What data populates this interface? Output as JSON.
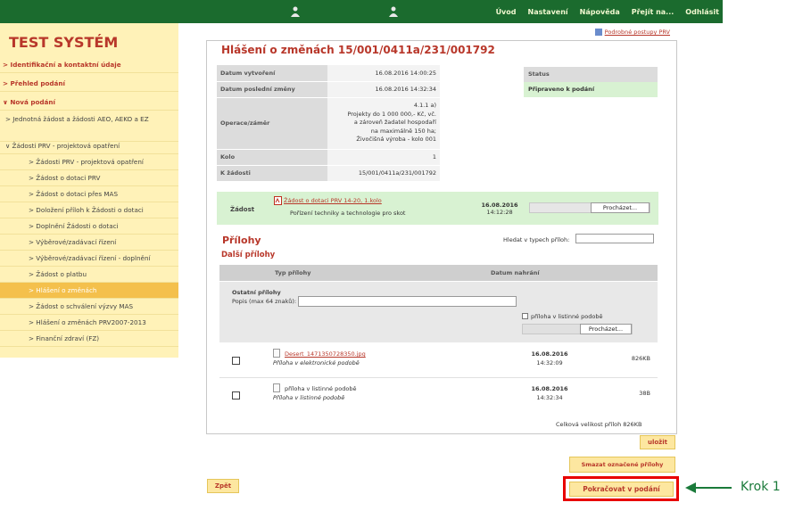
{
  "topnav": {
    "items": [
      "Úvod",
      "Nastavení",
      "Nápověda",
      "Přejít na...",
      "Odhlásit"
    ]
  },
  "sidebar": {
    "title": "TEST SYSTÉM",
    "items": [
      {
        "label": "> Identifikační a kontaktní údaje"
      },
      {
        "label": "> Přehled podání"
      },
      {
        "label": "∨ Nová podání"
      },
      {
        "label": "> Jednotná žádost a žádosti AEO, AEKO a EZ"
      },
      {
        "label": "∨ Žádosti PRV - projektová opatření"
      },
      {
        "label": "> Žádosti PRV - projektová opatření"
      },
      {
        "label": "> Žádost o dotaci PRV"
      },
      {
        "label": "> Žádost o dotaci přes MAS"
      },
      {
        "label": "> Doložení příloh k Žádosti o dotaci"
      },
      {
        "label": "> Doplnění Žádosti o dotaci"
      },
      {
        "label": "> Výběrové/zadávací řízení"
      },
      {
        "label": "> Výběrové/zadávací řízení - doplnění"
      },
      {
        "label": "> Žádost o platbu"
      },
      {
        "label": "> Hlášení o změnách"
      },
      {
        "label": "> Žádost o schválení výzvy MAS"
      },
      {
        "label": "> Hlášení o změnách PRV2007-2013"
      },
      {
        "label": "> Finanční zdraví (FZ)"
      }
    ]
  },
  "main": {
    "help_link": "Podrobné postupy PRV",
    "title": "Hlášení o změnách 15/001/0411a/231/001792",
    "info": [
      {
        "label": "Datum vytvoření",
        "value": "16.08.2016 14:00:25"
      },
      {
        "label": "Datum poslední změny",
        "value": "16.08.2016 14:32:34"
      },
      {
        "label": "Operace/záměr",
        "lines": [
          "4.1.1 a)",
          "Projekty do 1 000 000,- Kč, vč.",
          "a zároveň žadatel hospodaří",
          "na maximálně 150 ha;",
          "Živočišná výroba - kolo 001"
        ]
      },
      {
        "label": "Kolo",
        "value": "1"
      },
      {
        "label": "K žádosti",
        "value": "15/001/0411a/231/001792"
      }
    ],
    "status": {
      "header": "Status",
      "value": "Připraveno k podání"
    },
    "zadost": {
      "label": "Žádost",
      "file": "Žádost o dotaci PRV 14-20, 1.kolo",
      "description": "Pořízení techniky a technologie pro skot",
      "date": "16.08.2016",
      "time": "14:12:28",
      "browse": "Procházet..."
    },
    "prilohy": {
      "title": "Přílohy",
      "subtitle": "Další přílohy",
      "search_label": "Hledat v typech příloh:",
      "col_type": "Typ přílohy",
      "col_date": "Datum nahrání",
      "new": {
        "label": "Ostatní přílohy",
        "desc_label": "Popis (max 64 znaků):",
        "paper_label": "příloha v listinné podobě",
        "browse": "Procházet..."
      },
      "rows": [
        {
          "name": "Desert_1471350728350.jpg",
          "type": "Příloha v elektronické podobě",
          "date": "16.08.2016",
          "time": "14:32:09",
          "size": "826KB",
          "link": true
        },
        {
          "name": "příloha v listinné podobě",
          "type": "Příloha v listinné podobě",
          "date": "16.08.2016",
          "time": "14:32:34",
          "size": "38B",
          "link": false
        }
      ],
      "total": "Celková velikost příloh 826KB"
    },
    "buttons": {
      "save": "uložit",
      "delete": "Smazat označené přílohy",
      "back": "Zpět",
      "continue": "Pokračovat v podání"
    }
  },
  "annotation": {
    "label": "Krok 1",
    "color": "#1a7a3a",
    "highlight_color": "#e80000"
  }
}
